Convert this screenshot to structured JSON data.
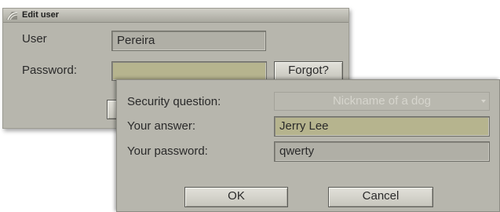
{
  "edit_user": {
    "title": "Edit user",
    "user_label": "User",
    "user_value": "Pereira",
    "password_label": "Password:",
    "password_value": "",
    "forgot_button": "Forgot?"
  },
  "security_dialog": {
    "question_label": "Security question:",
    "question_value": "Nickname of a dog",
    "answer_label": "Your answer:",
    "answer_value": "Jerry Lee",
    "password_label": "Your password:",
    "password_value": "qwerty",
    "ok_button": "OK",
    "cancel_button": "Cancel"
  },
  "colors": {
    "panel": "#b7b6ad",
    "field": "#b0afa6",
    "field_active": "#b6b48e"
  }
}
